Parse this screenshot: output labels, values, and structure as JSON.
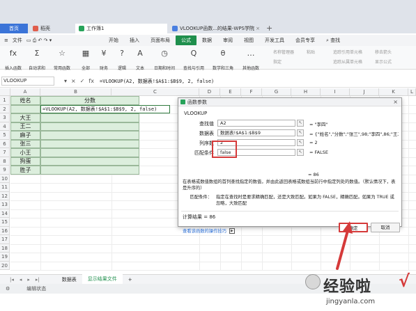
{
  "tabs": {
    "home": "首页",
    "daoke": "稻壳",
    "workbook": "工作簿1",
    "vlookup_tab": "VLOOKUP函数...的结果-WPS学院",
    "add": "+"
  },
  "menu": {
    "file": "文件",
    "items": [
      "开始",
      "插入",
      "页面布局",
      "公式",
      "数据",
      "审阅",
      "视图",
      "开发工具",
      "会员专享"
    ],
    "active": "公式",
    "search": "查找"
  },
  "ribbon": {
    "buttons": [
      {
        "glyph": "fx",
        "label": "插入函数"
      },
      {
        "glyph": "Σ",
        "label": "自动求和"
      },
      {
        "glyph": "☆",
        "label": "常用函数"
      },
      {
        "glyph": "▦",
        "label": "全部"
      },
      {
        "glyph": "¥",
        "label": "财务"
      },
      {
        "glyph": "?",
        "label": "逻辑"
      },
      {
        "glyph": "A",
        "label": "文本"
      },
      {
        "glyph": "◷",
        "label": "日期和时间"
      },
      {
        "glyph": "Q",
        "label": "查找与引用"
      },
      {
        "glyph": "θ",
        "label": "数学和三角"
      },
      {
        "glyph": "…",
        "label": "其他函数"
      }
    ],
    "right": [
      "名称管理器",
      "指定",
      "粘贴",
      "追踪引用单元格",
      "追踪从属单元格",
      "移去箭头",
      "显示公式",
      "公式求值"
    ]
  },
  "formula_bar": {
    "name_box": "VLOOKUP",
    "formula": "=VLOOKUP(A2, 数据表!$A$1:$B$9, 2, false)"
  },
  "grid": {
    "columns": [
      "A",
      "B",
      "C",
      "D",
      "E",
      "F",
      "G",
      "H",
      "I",
      "J",
      "K",
      "L"
    ],
    "rows": [
      "1",
      "2",
      "3",
      "4",
      "5",
      "6",
      "7",
      "8",
      "9",
      "10",
      "11",
      "12",
      "13",
      "14",
      "15",
      "16",
      "17",
      "18",
      "19",
      "20",
      "21",
      "22"
    ],
    "header_a": "姓名",
    "header_b": "分数",
    "b2_formula": "=VLOOKUP(A2, 数据表!$A$1:$B$9, 2, false)",
    "names": [
      "大王",
      "王二",
      "麻子",
      "张三",
      "小王",
      "狗蛋",
      "胜子"
    ]
  },
  "sheets": {
    "tabs": [
      "数据表",
      "显示结果文件"
    ],
    "active": "显示结果文件",
    "add": "+"
  },
  "status": {
    "mode": "编辑状态"
  },
  "dialog": {
    "title": "函数参数",
    "close": "×",
    "function_name": "VLOOKUP",
    "args": [
      {
        "label": "查找值",
        "value": "A2",
        "result": "= \"李四\""
      },
      {
        "label": "数据表",
        "value": "数据表!$A$1:$B$9",
        "result": "= {\"姓名\",\"分数\";\"张三\",98;\"李四\",86;\"王二..."
      },
      {
        "label": "列序数",
        "value": "2",
        "result": "= 2"
      },
      {
        "label": "匹配条件",
        "value": "false",
        "result": "= FALSE"
      }
    ],
    "overall_result": "= 86",
    "description": "在表格或数值数组的首列查找指定的数值，并由此返回表格或数组当前行中指定列处的数值。（默认情况下，表是升序的）",
    "detail_label": "匹配条件：",
    "detail_text": "指定在查找时是要求精确匹配，还是大致匹配。如果为 FALSE，精确匹配。如果为 TRUE 或忽略，大致匹配",
    "calc_result": "计算结果 = 86",
    "tip_link": "查看该函数的操作技巧",
    "ok": "确定",
    "cancel": "取消"
  },
  "watermark": {
    "main": "经验啦",
    "check": "√",
    "url": "jingyanla.com"
  },
  "colors": {
    "accent_green": "#1f8f4d",
    "highlight_red": "#d53a3a",
    "cell_fill": "#dceedd",
    "home_tab": "#3b74d8"
  }
}
